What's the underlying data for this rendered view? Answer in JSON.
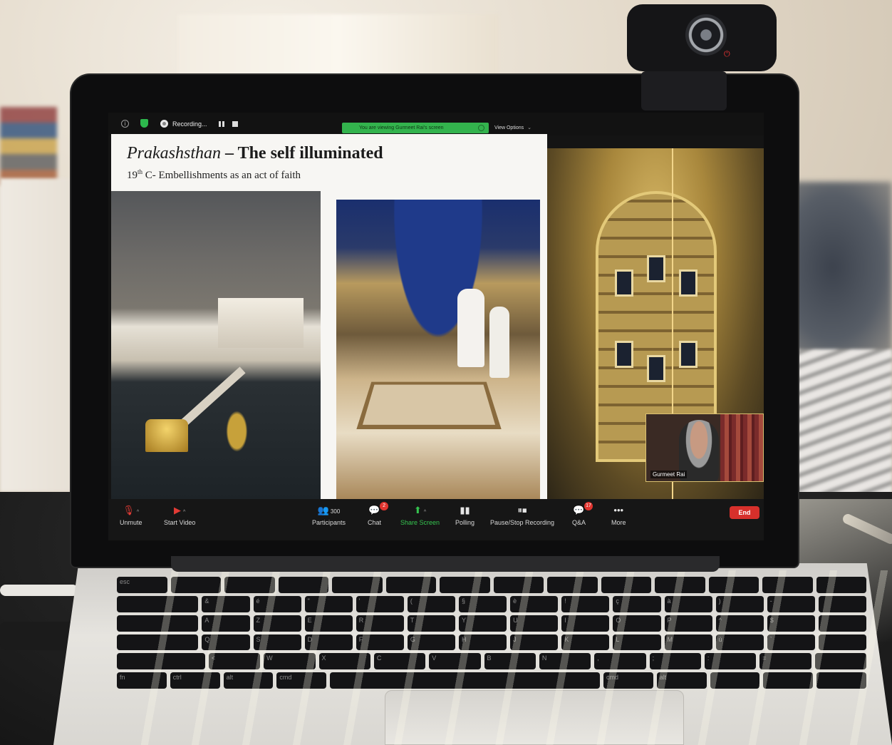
{
  "zoom": {
    "recording_label": "Recording...",
    "viewing_banner": "You are viewing Gurmeet Rai's screen",
    "view_options": "View Options",
    "toolbar": {
      "unmute": "Unmute",
      "start_video": "Start Video",
      "participants_label": "Participants",
      "participants_count": "300",
      "chat_label": "Chat",
      "chat_badge": "2",
      "share_screen": "Share Screen",
      "polling": "Polling",
      "pause_stop_recording": "Pause/Stop Recording",
      "qa_label": "Q&A",
      "qa_badge": "17",
      "more": "More",
      "end": "End"
    },
    "video_tile_name": "Gurmeet Rai"
  },
  "slide": {
    "title_italic": "Prakashsthan",
    "title_rest": " – The self illuminated",
    "subtitle_century": "19",
    "subtitle_sup": "th",
    "subtitle_rest": " C- Embellishments as an act of faith"
  },
  "keyboard": {
    "rows": [
      [
        "esc",
        "",
        "",
        "",
        "",
        "",
        "",
        "",
        "",
        "",
        "",
        "",
        "",
        ""
      ],
      [
        "",
        "&",
        "é",
        "\"",
        "'",
        "(",
        "§",
        "è",
        "!",
        "ç",
        "à",
        ")",
        "-",
        ""
      ],
      [
        "",
        "A",
        "Z",
        "E",
        "R",
        "T",
        "Y",
        "U",
        "I",
        "O",
        "P",
        "^",
        "$",
        ""
      ],
      [
        "",
        "Q",
        "S",
        "D",
        "F",
        "G",
        "H",
        "J",
        "K",
        "L",
        "M",
        "ù",
        "`",
        ""
      ],
      [
        "",
        "<",
        "W",
        "X",
        "C",
        "V",
        "B",
        "N",
        ",",
        ";",
        ":",
        "=",
        ""
      ],
      [
        "fn",
        "ctrl",
        "alt",
        "cmd",
        "",
        "cmd",
        "alt",
        "",
        "",
        ""
      ]
    ]
  },
  "colors": {
    "zoom_green": "#33b34d",
    "end_red": "#d7302b",
    "badge_red": "#e0342f"
  }
}
